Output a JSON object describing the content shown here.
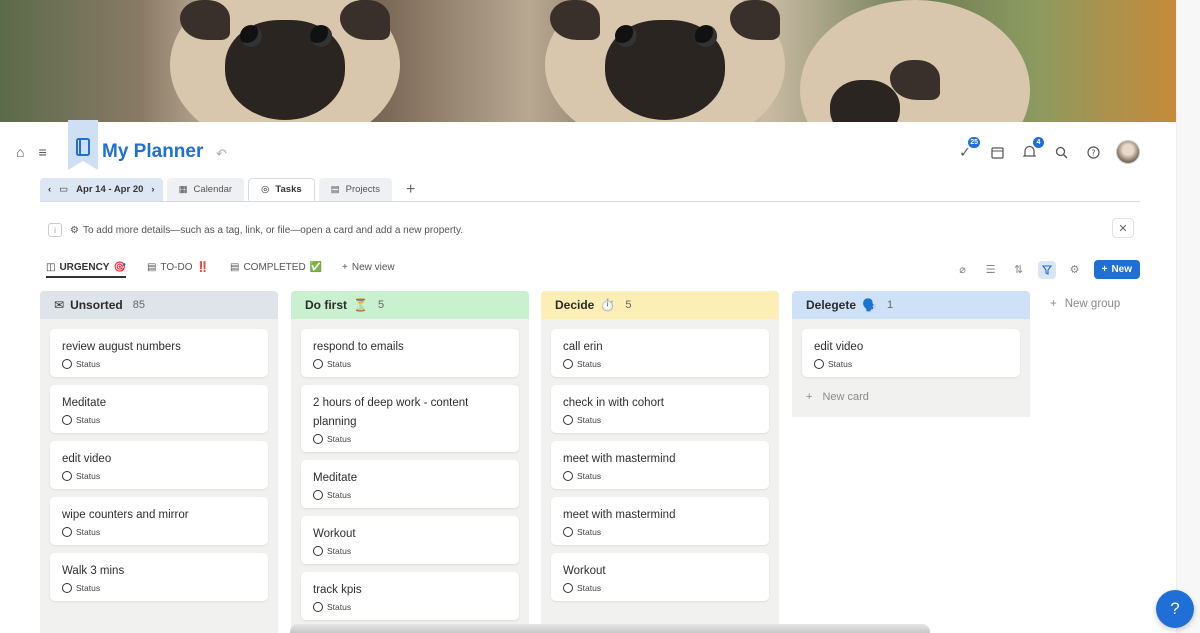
{
  "header": {
    "title": "My Planner",
    "tasks_badge": "25",
    "notifications_badge": "4"
  },
  "tabs": {
    "date_range": "Apr 14 - Apr 20",
    "items": [
      "Calendar",
      "Tasks",
      "Projects"
    ],
    "add": "+"
  },
  "banner": {
    "text": "To add more details—such as a tag, link, or file—open a card and add a new property.",
    "close": "✕"
  },
  "views": {
    "items": [
      {
        "label": "URGENCY",
        "emoji": "🎯"
      },
      {
        "label": "TO-DO",
        "emoji": "‼️"
      },
      {
        "label": "COMPLETED",
        "emoji": "✅"
      }
    ],
    "new_view": "New view",
    "new_button": "New"
  },
  "columns": [
    {
      "name": "Unsorted",
      "emoji": "",
      "count": "85",
      "color": "#dfe3ea",
      "cards": [
        "review august numbers",
        "Meditate",
        "edit video",
        "wipe counters and mirror",
        "Walk 3 mins"
      ]
    },
    {
      "name": "Do first",
      "emoji": "⏳",
      "count": "5",
      "color": "#c9f0cf",
      "cards": [
        "respond to emails",
        "2 hours of deep work - content planning",
        "Meditate",
        "Workout",
        "track kpis"
      ]
    },
    {
      "name": "Decide",
      "emoji": "⏱️",
      "count": "5",
      "color": "#fbefb5",
      "cards": [
        "call erin",
        "check in with cohort",
        "meet with mastermind",
        "meet with mastermind",
        "Workout"
      ]
    },
    {
      "name": "Delegete",
      "emoji": "🗣️",
      "count": "1",
      "color": "#cfe1f7",
      "cards": [
        "edit video"
      ]
    }
  ],
  "status_label": "Status",
  "new_card": "New card",
  "new_group": "New group",
  "help": "?"
}
